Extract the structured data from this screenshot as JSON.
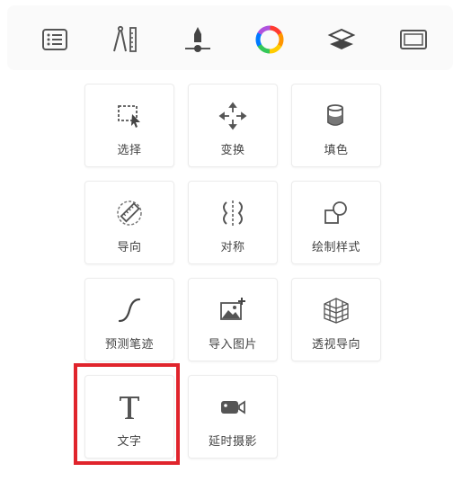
{
  "toolbar": {
    "items": [
      {
        "icon": "list-icon"
      },
      {
        "icon": "ruler-compass-icon"
      },
      {
        "icon": "brush-slider-icon"
      },
      {
        "icon": "color-wheel-icon"
      },
      {
        "icon": "layers-icon"
      },
      {
        "icon": "canvas-frame-icon"
      }
    ]
  },
  "tools": [
    {
      "label": "选择",
      "icon": "selection-icon"
    },
    {
      "label": "变换",
      "icon": "transform-icon"
    },
    {
      "label": "填色",
      "icon": "fill-bucket-icon"
    },
    {
      "label": "导向",
      "icon": "ruler-guide-icon"
    },
    {
      "label": "对称",
      "icon": "symmetry-icon"
    },
    {
      "label": "绘制样式",
      "icon": "draw-style-icon"
    },
    {
      "label": "预测笔迹",
      "icon": "predict-stroke-icon"
    },
    {
      "label": "导入图片",
      "icon": "import-image-icon"
    },
    {
      "label": "透视导向",
      "icon": "perspective-grid-icon"
    },
    {
      "label": "文字",
      "icon": "text-icon"
    },
    {
      "label": "延时摄影",
      "icon": "timelapse-camera-icon"
    }
  ],
  "highlight": {
    "color": "#e0242c",
    "target": "文字"
  }
}
